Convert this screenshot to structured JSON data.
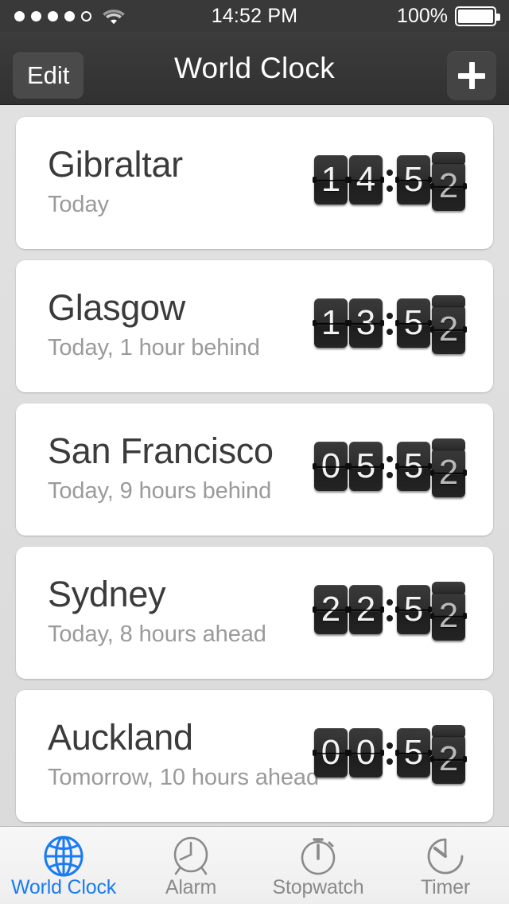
{
  "status_bar": {
    "signal_dots_filled": 4,
    "signal_dots_total": 5,
    "wifi_icon": "wifi-icon",
    "time": "14:52 PM",
    "battery_percent": "100%",
    "battery_level": 100
  },
  "nav_bar": {
    "edit_label": "Edit",
    "title": "World Clock",
    "add_icon": "plus-icon"
  },
  "colors": {
    "accent": "#1a7bf2",
    "nav_background": "#343434",
    "page_background": "#dddddd",
    "card_background": "#ffffff",
    "city_text": "#3b3b3b",
    "subtitle_text": "#9a9a9a",
    "tab_inactive": "#8a8a8a",
    "flip_tile": "#2b2b2b"
  },
  "clocks": [
    {
      "city": "Gibraltar",
      "subtitle": "Today",
      "time": "14:52",
      "digits": [
        "1",
        "4",
        "5",
        "2"
      ],
      "flipping_index": 3
    },
    {
      "city": "Glasgow",
      "subtitle": "Today, 1 hour behind",
      "time": "13:52",
      "digits": [
        "1",
        "3",
        "5",
        "2"
      ],
      "flipping_index": 3
    },
    {
      "city": "San Francisco",
      "subtitle": "Today, 9 hours behind",
      "time": "05:52",
      "digits": [
        "0",
        "5",
        "5",
        "2"
      ],
      "flipping_index": 3
    },
    {
      "city": "Sydney",
      "subtitle": "Today, 8 hours ahead",
      "time": "22:52",
      "digits": [
        "2",
        "2",
        "5",
        "2"
      ],
      "flipping_index": 3
    },
    {
      "city": "Auckland",
      "subtitle": "Tomorrow, 10 hours ahead",
      "time": "00:52",
      "digits": [
        "0",
        "0",
        "5",
        "2"
      ],
      "flipping_index": 3
    }
  ],
  "tab_bar": {
    "active_index": 0,
    "tabs": [
      {
        "label": "World Clock",
        "icon": "globe-icon"
      },
      {
        "label": "Alarm",
        "icon": "alarm-clock-icon"
      },
      {
        "label": "Stopwatch",
        "icon": "stopwatch-icon"
      },
      {
        "label": "Timer",
        "icon": "timer-icon"
      }
    ]
  }
}
